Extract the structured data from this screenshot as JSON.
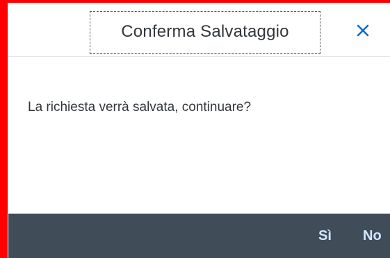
{
  "dialog": {
    "title": "Conferma Salvataggio",
    "message": "La richiesta verrà salvata, continuare?",
    "close_icon": "close-icon",
    "buttons": {
      "yes_label": "Sì",
      "no_label": "No"
    }
  },
  "colors": {
    "highlight_border": "#ff0000",
    "footer_background": "#404c58",
    "footer_button_text": "#d1e8ff",
    "text": "#32363a",
    "close_icon": "#0a6ed1"
  }
}
